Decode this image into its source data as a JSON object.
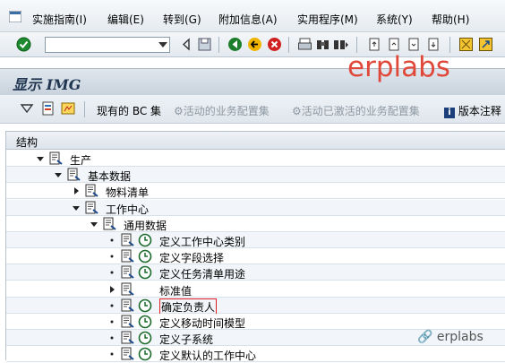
{
  "menu": {
    "items": [
      "实施指南(I)",
      "编辑(E)",
      "转到(G)",
      "附加信息(A)",
      "实用程序(M)",
      "系统(Y)",
      "帮助(H)"
    ]
  },
  "title": "显示 IMG",
  "watermark": "erplabs",
  "app_toolbar": {
    "bc_sets": "现有的 BC 集",
    "active_bc": "活动的业务配置集",
    "activated_bc": "活动已激活的业务配置集",
    "release_notes": "版本注释"
  },
  "tree": {
    "header": "结构",
    "nodes": [
      {
        "label": "生产",
        "level": 0,
        "state": "expanded"
      },
      {
        "label": "基本数据",
        "level": 1,
        "state": "expanded"
      },
      {
        "label": "物料清单",
        "level": 2,
        "state": "collapsed"
      },
      {
        "label": "工作中心",
        "level": 2,
        "state": "expanded"
      },
      {
        "label": "通用数据",
        "level": 3,
        "state": "expanded"
      },
      {
        "label": "定义工作中心类别",
        "level": 4,
        "state": "leaf"
      },
      {
        "label": "定义字段选择",
        "level": 4,
        "state": "leaf"
      },
      {
        "label": "定义任务清单用途",
        "level": 4,
        "state": "leaf"
      },
      {
        "label": "标准值",
        "level": 4,
        "state": "collapsed"
      },
      {
        "label": "确定负责人",
        "level": 4,
        "state": "leaf",
        "selected": true
      },
      {
        "label": "定义移动时间模型",
        "level": 4,
        "state": "leaf"
      },
      {
        "label": "定义子系统",
        "level": 4,
        "state": "leaf"
      },
      {
        "label": "定义默认的工作中心",
        "level": 4,
        "state": "leaf"
      }
    ]
  },
  "footer_mark": "erplabs"
}
